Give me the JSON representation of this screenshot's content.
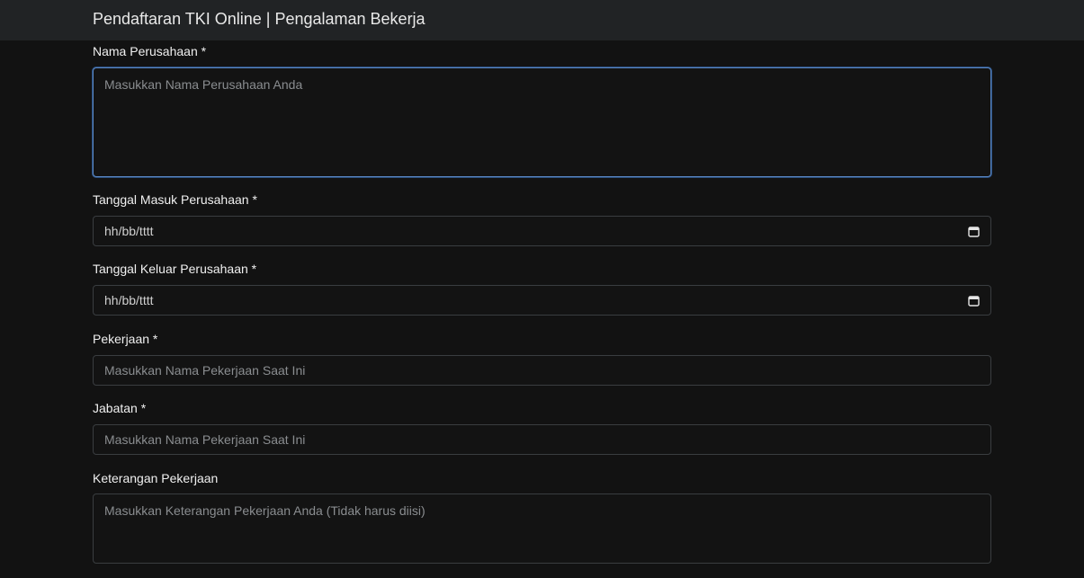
{
  "header": {
    "title": "Pendaftaran TKI Online | Pengalaman Bekerja"
  },
  "form": {
    "company_name": {
      "label": "Nama Perusahaan *",
      "placeholder": "Masukkan Nama Perusahaan Anda",
      "value": ""
    },
    "start_date": {
      "label": "Tanggal Masuk Perusahaan *",
      "display": "hh/bb/tttt",
      "icon": "calendar-icon"
    },
    "end_date": {
      "label": "Tanggal Keluar Perusahaan *",
      "display": "hh/bb/tttt",
      "icon": "calendar-icon"
    },
    "job": {
      "label": "Pekerjaan *",
      "placeholder": "Masukkan Nama Pekerjaan Saat Ini",
      "value": ""
    },
    "position": {
      "label": "Jabatan *",
      "placeholder": "Masukkan Nama Pekerjaan Saat Ini",
      "value": ""
    },
    "job_description": {
      "label": "Keterangan Pekerjaan",
      "placeholder": "Masukkan Keterangan Pekerjaan Anda (Tidak harus diisi)",
      "value": ""
    }
  },
  "colors": {
    "background": "#121212",
    "header": "#212325",
    "focus_border": "#5a86c2",
    "input_border": "#3a3d40"
  }
}
